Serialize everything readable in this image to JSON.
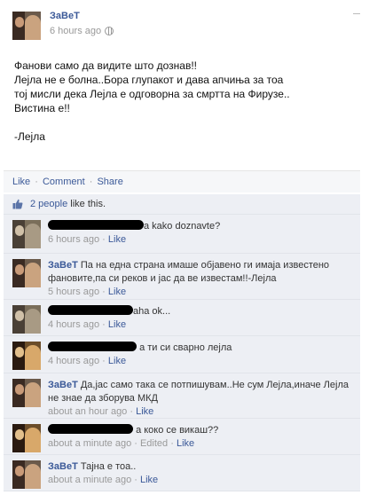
{
  "post": {
    "author": "ЗаВеТ",
    "timestamp": "6 hours ago",
    "lines": [
      "Фанови само да видите што дознав!!",
      "Лејла не е болна..Бора глупакот и дава апчиња за тоа",
      "тој мисли дека Лејла е одговорна за смртта на Фирузе..",
      "Вистина е!!",
      "",
      "-Лејла"
    ]
  },
  "actions": {
    "like": "Like",
    "comment": "Comment",
    "share": "Share",
    "sep": "·"
  },
  "likes": {
    "link": "2 people",
    "rest": " like this."
  },
  "comments": [
    {
      "name": "",
      "text": "a kako doznavte?",
      "time": "6 hours ago",
      "like": "Like",
      "avatar": "redact"
    },
    {
      "name": "ЗаВеТ",
      "text": "Па на една страна имаше објавено ги имаја известено фановите,па си реков и јас да ве известам!!-Лејла",
      "time": "5 hours ago",
      "like": "Like",
      "avatar": "couple"
    },
    {
      "name": "",
      "text": "aha ok...",
      "time": "4 hours ago",
      "like": "Like",
      "avatar": "redact"
    },
    {
      "name": "",
      "text": "а ти си сварно лејла",
      "time": "4 hours ago",
      "like": "Like",
      "avatar": "girl"
    },
    {
      "name": "ЗаВеТ",
      "text": "Да,јас само така се потпишувам..Не сум Лејла,иначе Лејла не знае да зборува МКД",
      "time": "about an hour ago",
      "like": "Like",
      "avatar": "couple"
    },
    {
      "name": "",
      "text": "а коко се викаш??",
      "time": "about a minute ago",
      "edited": "Edited",
      "like": "Like",
      "avatar": "girl"
    },
    {
      "name": "ЗаВеТ",
      "text": "Тајна е тоа..",
      "time": "about a minute ago",
      "like": "Like",
      "avatar": "couple"
    }
  ]
}
